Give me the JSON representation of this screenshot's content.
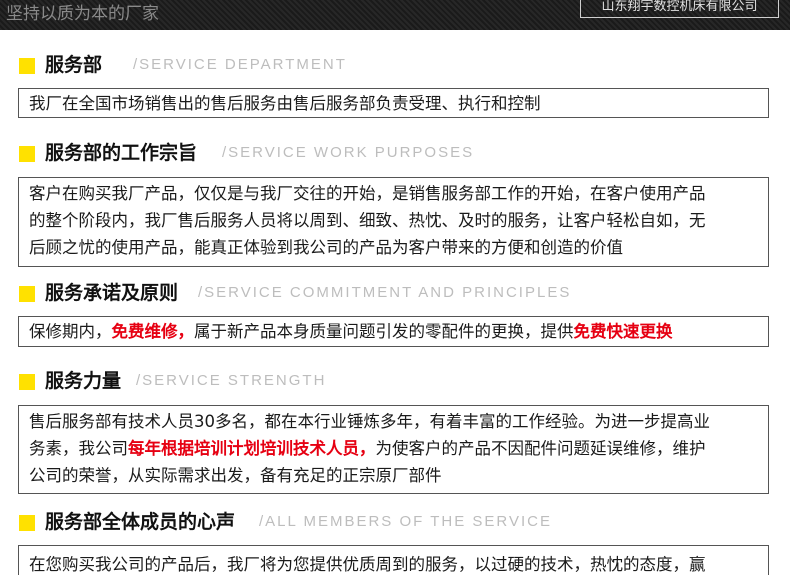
{
  "header": {
    "slogan": "坚持以质为本的厂家",
    "company": "山东翔宇数控机床有限公司"
  },
  "sections": [
    {
      "title": "服务部",
      "subtitle": "/SERVICE DEPARTMENT",
      "lines": [
        [
          "我厂在全国市场销售出的售后服务由售后服务部负责受理、执行和控制"
        ]
      ]
    },
    {
      "title": "服务部的工作宗旨",
      "subtitle": "/SERVICE WORK PURPOSES",
      "lines": [
        [
          "客户在购买我厂产品，仅仅是与我厂交往的开始，是销售服务部工作的开始，在客户使用产品"
        ],
        [
          "的整个阶段内，我厂售后服务人员将以周到、细致、热忱、及时的服务，让客户轻松自如，无"
        ],
        [
          "后顾之忧的使用产品，能真正体验到我公司的产品为客户带来的方便和创造的价值"
        ]
      ]
    },
    {
      "title": "服务承诺及原则",
      "subtitle": "/SERVICE COMMITMENT AND PRINCIPLES",
      "line_parts": [
        "保修期内，",
        "免费维修，",
        "属于新产品本身质量问题引发的零配件的更换，提供",
        "免费快速更换"
      ]
    },
    {
      "title": "服务力量",
      "subtitle": "/SERVICE STRENGTH",
      "line1": "售后服务部有技术人员30多名，都在本行业锤炼多年，有着丰富的工作经验。为进一步提高业",
      "line2_parts": [
        "务素，我公司",
        "每年根据培训计划培训技术人员，",
        "为使客户的产品不因配件问题延误维修，维护"
      ],
      "line3": "公司的荣誉，从实际需求出发，备有充足的正宗原厂部件"
    },
    {
      "title": "服务部全体成员的心声",
      "subtitle": "/ALL MEMBERS OF THE SERVICE",
      "line1": "在您购买我公司的产品后，我厂将为您提供优质周到的服务，以过硬的技术，热忱的态度，赢"
    }
  ],
  "colors": {
    "marker": "#ffe100",
    "emphasis": "#e60012",
    "topbar": "#1a1a1a"
  }
}
